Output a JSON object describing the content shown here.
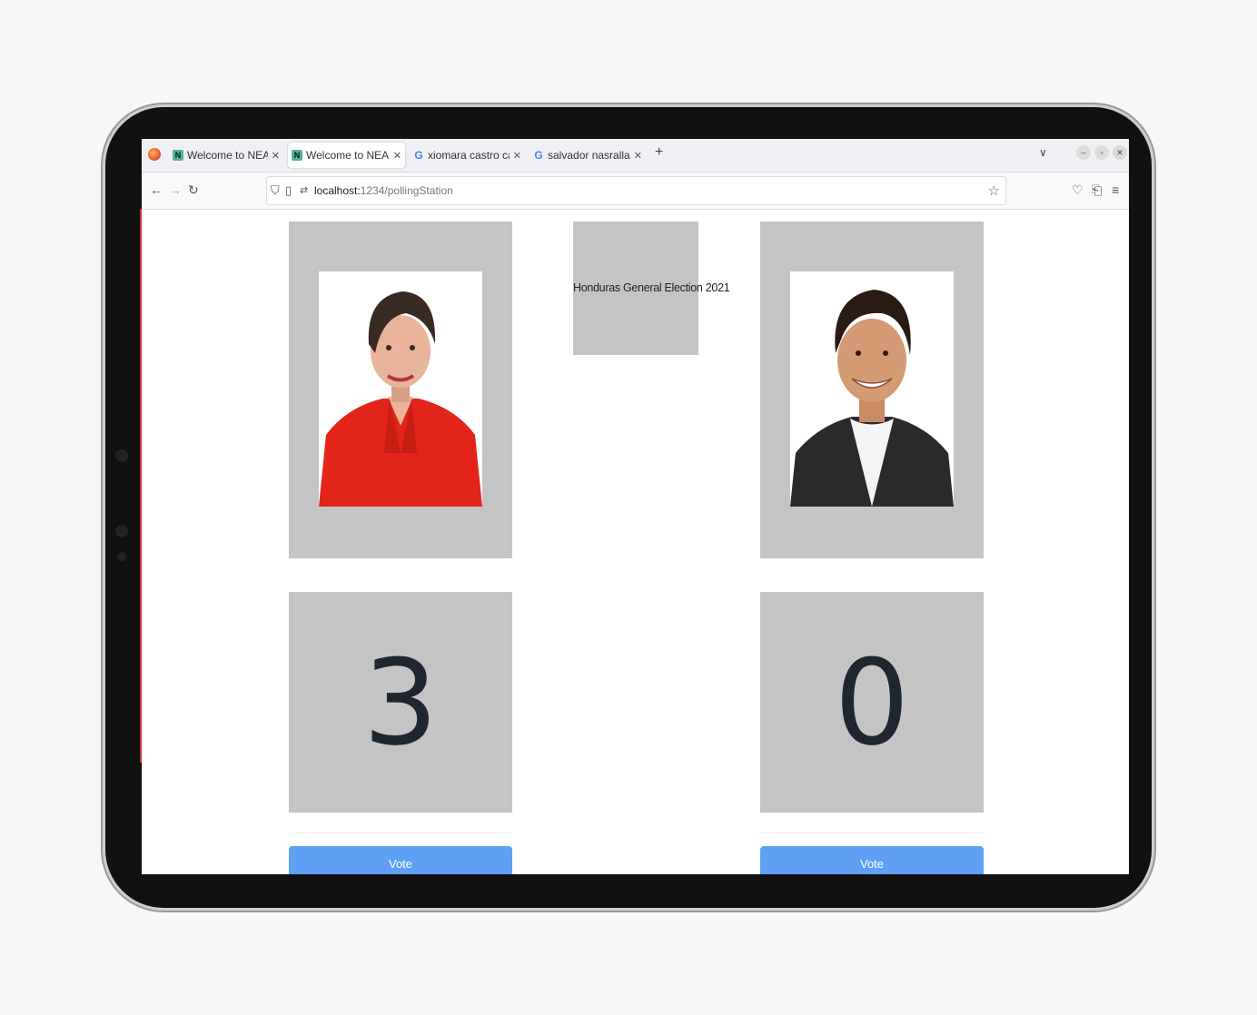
{
  "browser": {
    "tabs": [
      {
        "label": "Welcome to NEAR with R",
        "favicon": "near-icon",
        "active": false
      },
      {
        "label": "Welcome to NEAR with R",
        "favicon": "near-icon",
        "active": true
      },
      {
        "label": "xiomara castro campaña",
        "favicon": "google-icon",
        "active": false
      },
      {
        "label": "salvador nasralla - Googl",
        "favicon": "google-icon",
        "active": false
      }
    ],
    "new_tab": "+",
    "url_host": "localhost:",
    "url_path": "1234/pollingStation"
  },
  "election": {
    "title": "Honduras General Election 2021"
  },
  "candidates": [
    {
      "votes": "3",
      "vote_label": "Vote",
      "shirt_color": "#e3241b"
    },
    {
      "votes": "0",
      "vote_label": "Vote",
      "shirt_color": "#2a2a2a"
    }
  ],
  "colors": {
    "panel": "#c4c4c4",
    "vote_button": "#5fa0f5"
  }
}
